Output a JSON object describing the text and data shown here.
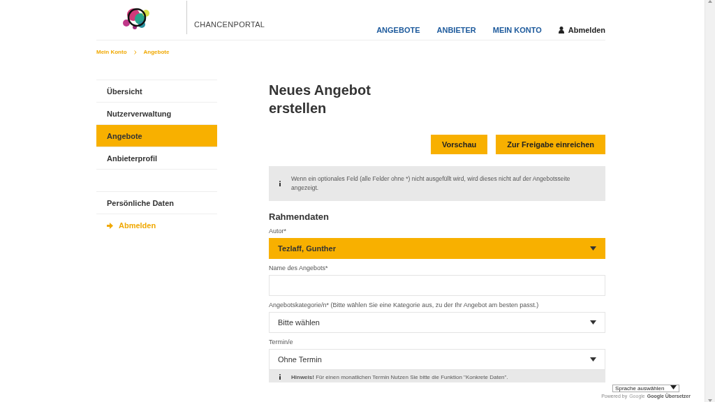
{
  "header": {
    "brand": "CHANCENPORTAL",
    "nav": [
      {
        "label": "ANGEBOTE",
        "kind": "link"
      },
      {
        "label": "ANBIETER",
        "kind": "link"
      },
      {
        "label": "MEIN KONTO",
        "kind": "link"
      },
      {
        "label": "Abmelden",
        "kind": "user"
      }
    ]
  },
  "breadcrumb": [
    "Mein Konto",
    "Angebote"
  ],
  "sidebar": {
    "items": [
      {
        "label": "Übersicht",
        "selected": false
      },
      {
        "label": "Nutzerverwaltung",
        "selected": false
      },
      {
        "label": "Angebote",
        "selected": true
      },
      {
        "label": "Anbieterprofil",
        "selected": false
      }
    ],
    "personal": "Persönliche Daten",
    "logout": "Abmelden"
  },
  "main": {
    "title": "Neues Angebot erstellen",
    "buttons": [
      "Vorschau",
      "Zur Freigabe einreichen"
    ],
    "info": "Wenn ein optionales Feld (alle Felder ohne *) nicht ausgefüllt wird, wird dieses nicht auf der Angebotsseite angezeigt.",
    "section": "Rahmendaten",
    "fields": [
      {
        "label": "Autor*",
        "kind": "select",
        "value": "Tezlaff, Gunther",
        "highlighted": true
      },
      {
        "label": "Name des Angebots*",
        "kind": "text"
      },
      {
        "label": "Angebotskategorie/n* (Bitte wählen Sie eine Kategorie aus, zu der Ihr Angebot am besten passt.)",
        "kind": "select",
        "value": "Bitte wählen",
        "highlighted": false
      },
      {
        "label": "Termin/e",
        "kind": "select",
        "value": "Ohne Termin",
        "highlighted": false
      }
    ],
    "hint": "**Hinweis!** Für einen monatlichen Termin Nutzen Sie bitte die Funktion \"Konkrete Daten\"."
  },
  "translate": {
    "select": "Sprache auswählen",
    "powered": "Powered by",
    "google": "Google",
    "service": "Google Übersetzer"
  }
}
